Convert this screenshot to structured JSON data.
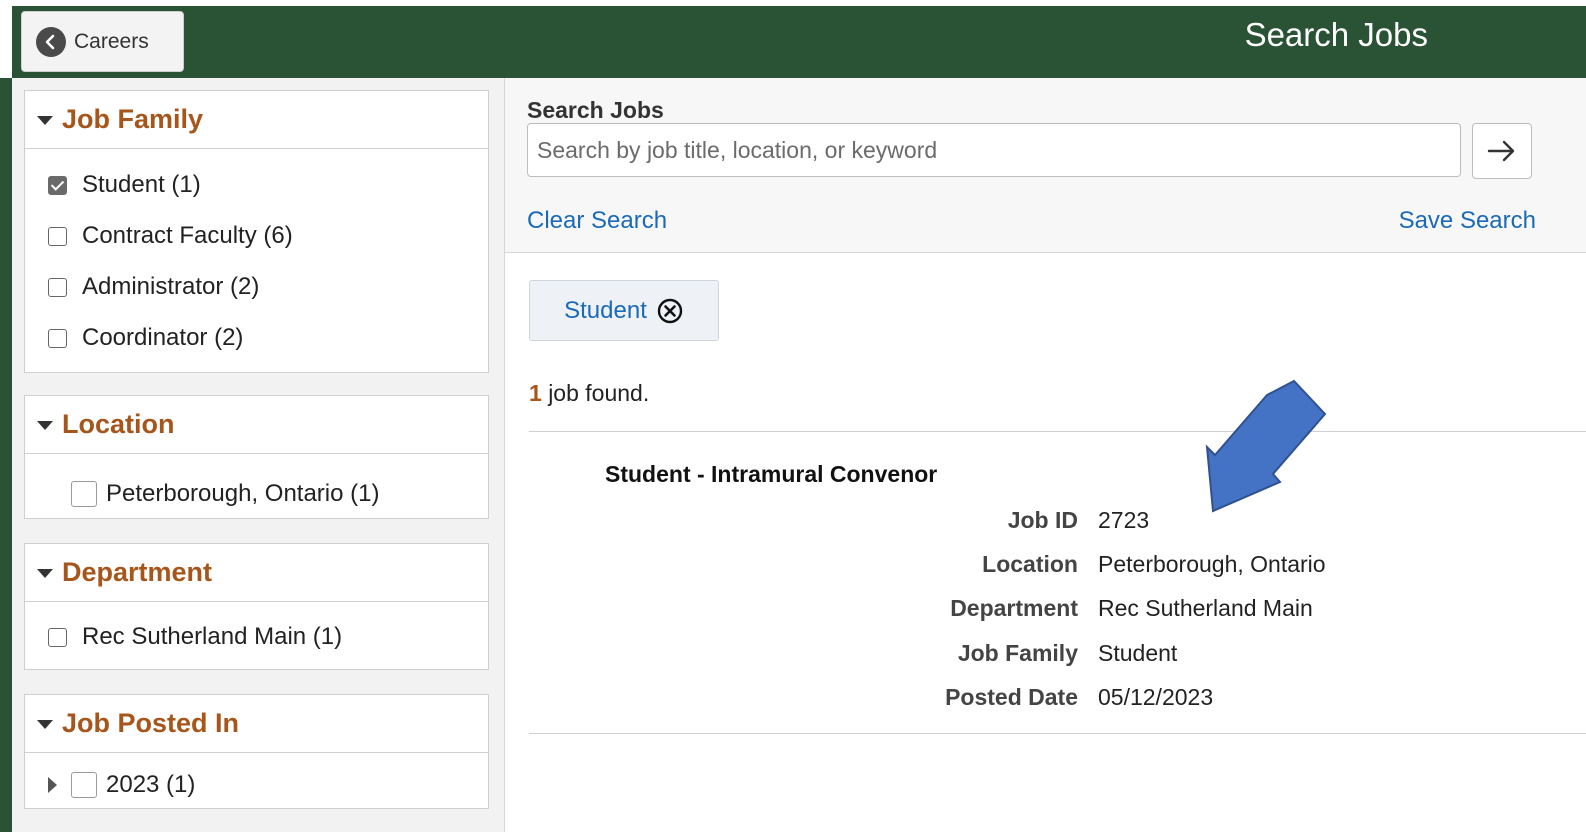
{
  "header": {
    "back_label": "Careers",
    "title": "Search Jobs",
    "back_icon": "chevron-left-icon",
    "bar_color": "#2a5235"
  },
  "filters": {
    "job_family": {
      "title": "Job Family",
      "options": [
        {
          "label": "Student (1)",
          "checked": true
        },
        {
          "label": "Contract Faculty (6)",
          "checked": false
        },
        {
          "label": "Administrator (2)",
          "checked": false
        },
        {
          "label": "Coordinator (2)",
          "checked": false
        }
      ]
    },
    "location": {
      "title": "Location",
      "options": [
        {
          "label": "Peterborough, Ontario (1)",
          "checked": false
        }
      ]
    },
    "department": {
      "title": "Department",
      "options": [
        {
          "label": "Rec Sutherland Main (1)",
          "checked": false
        }
      ]
    },
    "job_posted_in": {
      "title": "Job Posted In",
      "options": [
        {
          "label": "2023 (1)",
          "checked": false
        }
      ]
    }
  },
  "search": {
    "label": "Search Jobs",
    "placeholder": "Search by job title, location, or keyword",
    "value": "",
    "clear_label": "Clear Search",
    "save_label": "Save Search",
    "go_icon": "arrow-right-icon"
  },
  "active_filter_chip": {
    "label": "Student",
    "icon": "remove-circle-icon"
  },
  "results": {
    "count": "1",
    "count_suffix": "job found.",
    "jobs": [
      {
        "title": "Student - Intramural Convenor",
        "fields": [
          {
            "label": "Job ID",
            "value": "2723"
          },
          {
            "label": "Location",
            "value": "Peterborough, Ontario"
          },
          {
            "label": "Department",
            "value": "Rec Sutherland Main"
          },
          {
            "label": "Job Family",
            "value": "Student"
          },
          {
            "label": "Posted Date",
            "value": "05/12/2023"
          }
        ]
      }
    ]
  },
  "annotation": {
    "icon": "blue-pointer-arrow-icon",
    "color": "#4472c4"
  }
}
